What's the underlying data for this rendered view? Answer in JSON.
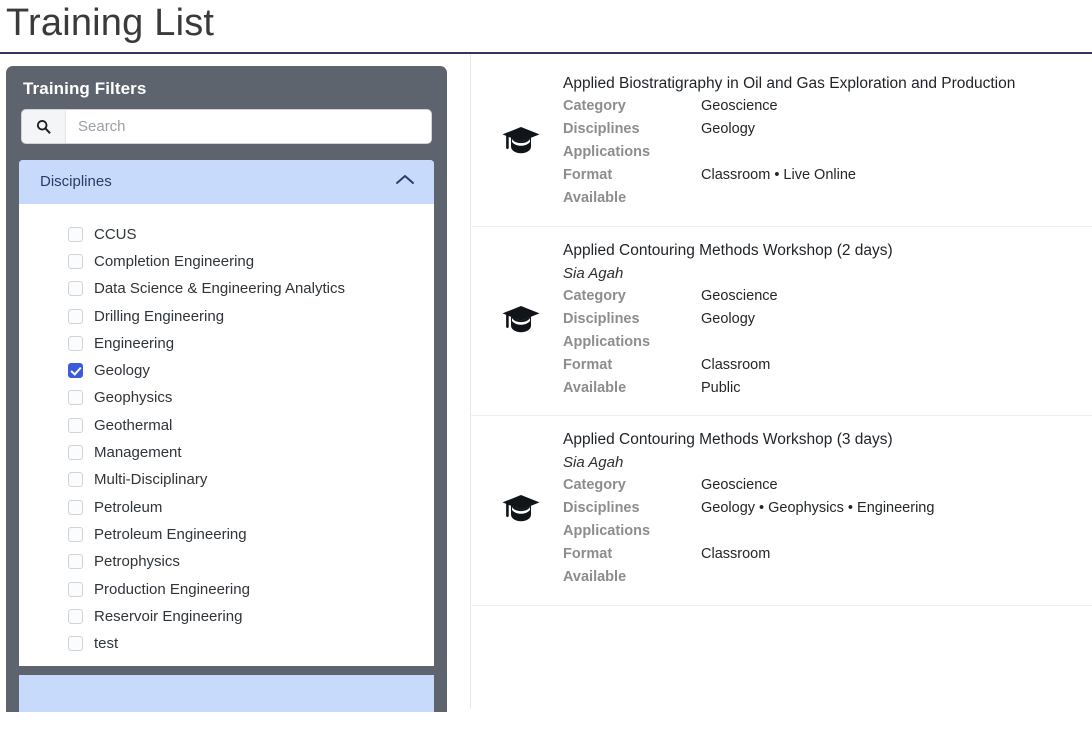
{
  "header": {
    "title": "Training List",
    "rule_color": "#3b3260"
  },
  "sidebar": {
    "panel_title": "Training Filters",
    "panel_bg": "#5d646e",
    "search": {
      "placeholder": "Search",
      "value": "",
      "icon": "search-icon"
    },
    "accordion": {
      "label": "Disciplines",
      "expanded": true,
      "chevron_icon": "chevron-up-icon",
      "header_bg": "#c8dafb",
      "options": [
        {
          "label": "CCUS",
          "checked": false
        },
        {
          "label": "Completion Engineering",
          "checked": false
        },
        {
          "label": "Data Science & Engineering Analytics",
          "checked": false
        },
        {
          "label": "Drilling Engineering",
          "checked": false
        },
        {
          "label": "Engineering",
          "checked": false
        },
        {
          "label": "Geology",
          "checked": true
        },
        {
          "label": "Geophysics",
          "checked": false
        },
        {
          "label": "Geothermal",
          "checked": false
        },
        {
          "label": "Management",
          "checked": false
        },
        {
          "label": "Multi-Disciplinary",
          "checked": false
        },
        {
          "label": "Petroleum",
          "checked": false
        },
        {
          "label": "Petroleum Engineering",
          "checked": false
        },
        {
          "label": "Petrophysics",
          "checked": false
        },
        {
          "label": "Production Engineering",
          "checked": false
        },
        {
          "label": "Reservoir Engineering",
          "checked": false
        },
        {
          "label": "test",
          "checked": false
        }
      ]
    },
    "checkbox_accent": "#3b5bdb"
  },
  "results": {
    "field_labels": {
      "category": "Category",
      "disciplines": "Disciplines",
      "applications": "Applications",
      "format": "Format",
      "available": "Available"
    },
    "cards": [
      {
        "icon": "graduation-cap-icon",
        "title": "Applied Biostratigraphy in Oil and Gas Exploration and Production",
        "author": "",
        "category": "Geoscience",
        "disciplines": "Geology",
        "applications": "",
        "format": "Classroom • Live Online",
        "available": ""
      },
      {
        "icon": "graduation-cap-icon",
        "title": "Applied Contouring Methods Workshop (2 days)",
        "author": "Sia Agah",
        "category": "Geoscience",
        "disciplines": "Geology",
        "applications": "",
        "format": "Classroom",
        "available": "Public"
      },
      {
        "icon": "graduation-cap-icon",
        "title": "Applied Contouring Methods Workshop  (3 days)",
        "author": "Sia Agah",
        "category": "Geoscience",
        "disciplines": "Geology • Geophysics • Engineering",
        "applications": "",
        "format": "Classroom",
        "available": ""
      }
    ]
  }
}
